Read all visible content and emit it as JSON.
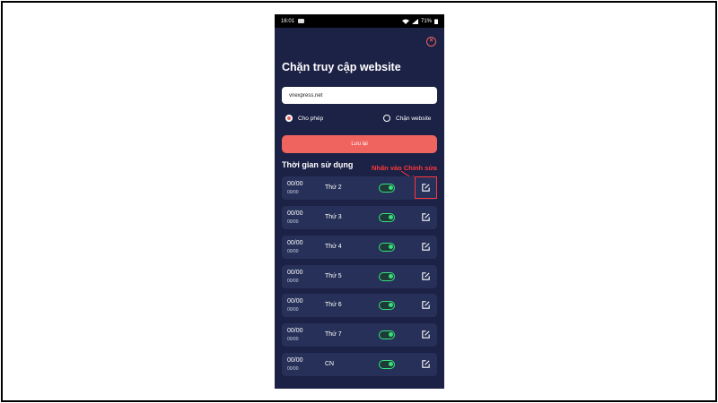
{
  "status_bar": {
    "time": "16:01",
    "battery": "71%"
  },
  "dialog": {
    "title": "Chặn truy cập website",
    "url_value": "vnexpress.net",
    "radio_options": [
      {
        "label": "Cho phép",
        "checked": true
      },
      {
        "label": "Chặn website",
        "checked": false
      }
    ],
    "save_label": "Lưu lại",
    "section_title": "Thời gian sử dụng"
  },
  "annotation": {
    "text": "Nhấn vào Chỉnh sửa",
    "color": "#ff3838"
  },
  "schedule": [
    {
      "time_main": "00/00",
      "time_sub": "00/00",
      "day": "Thứ 2",
      "enabled": true
    },
    {
      "time_main": "00/00",
      "time_sub": "00/00",
      "day": "Thứ 3",
      "enabled": true
    },
    {
      "time_main": "00/00",
      "time_sub": "00/00",
      "day": "Thứ 4",
      "enabled": true
    },
    {
      "time_main": "00/00",
      "time_sub": "00/00",
      "day": "Thứ 5",
      "enabled": true
    },
    {
      "time_main": "00/00",
      "time_sub": "00/00",
      "day": "Thứ 6",
      "enabled": true
    },
    {
      "time_main": "00/00",
      "time_sub": "00/00",
      "day": "Thứ 7",
      "enabled": true
    },
    {
      "time_main": "00/00",
      "time_sub": "00/00",
      "day": "CN",
      "enabled": true
    }
  ],
  "colors": {
    "background": "#1c2146",
    "row": "#263058",
    "accent": "#f0645f",
    "toggle_on": "#36e07a"
  },
  "icons": [
    "close-icon",
    "edit-icon",
    "wifi-icon",
    "signal-icon",
    "battery-icon"
  ]
}
